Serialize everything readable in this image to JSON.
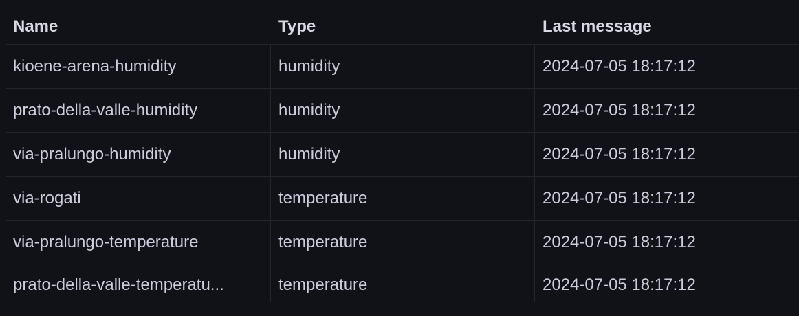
{
  "table": {
    "columns": [
      "Name",
      "Type",
      "Last message"
    ],
    "rows": [
      {
        "name": "kioene-arena-humidity",
        "type": "humidity",
        "last_message": "2024-07-05 18:17:12"
      },
      {
        "name": "prato-della-valle-humidity",
        "type": "humidity",
        "last_message": "2024-07-05 18:17:12"
      },
      {
        "name": "via-pralungo-humidity",
        "type": "humidity",
        "last_message": "2024-07-05 18:17:12"
      },
      {
        "name": "via-rogati",
        "type": "temperature",
        "last_message": "2024-07-05 18:17:12"
      },
      {
        "name": "via-pralungo-temperature",
        "type": "temperature",
        "last_message": "2024-07-05 18:17:12"
      },
      {
        "name": "prato-della-valle-temperatu...",
        "type": "temperature",
        "last_message": "2024-07-05 18:17:12"
      }
    ]
  },
  "colors": {
    "background": "#111217",
    "text": "#ccccdc",
    "header_text": "#d8d9e3",
    "divider": "#25262d"
  }
}
